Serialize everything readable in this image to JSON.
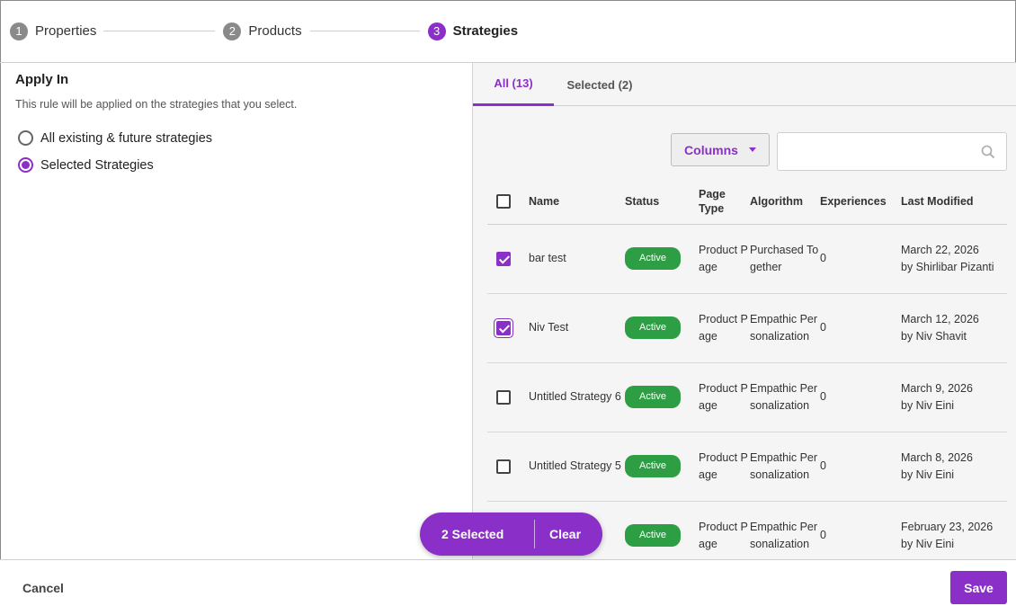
{
  "stepper": {
    "steps": [
      {
        "num": "1",
        "label": "Properties"
      },
      {
        "num": "2",
        "label": "Products"
      },
      {
        "num": "3",
        "label": "Strategies"
      }
    ]
  },
  "apply": {
    "title": "Apply In",
    "description": "This rule will be applied on the strategies that you select.",
    "options": [
      {
        "label": "All existing & future strategies",
        "checked": false
      },
      {
        "label": "Selected Strategies",
        "checked": true
      }
    ]
  },
  "tabs": [
    {
      "label": "All (13)",
      "active": true
    },
    {
      "label": "Selected (2)",
      "active": false
    }
  ],
  "toolbar": {
    "columns_label": "Columns",
    "search_placeholder": ""
  },
  "table": {
    "headers": [
      "Name",
      "Status",
      "Page Type",
      "Algorithm",
      "Experiences",
      "Last Modified"
    ],
    "rows": [
      {
        "checked": true,
        "name": "bar test",
        "status": "Active",
        "page_type": "Product Page",
        "algorithm": "Purchased Together",
        "experiences": "0",
        "modified_date": "March 22, 2026",
        "modified_by": "by Shirlibar Pizanti"
      },
      {
        "checked": true,
        "name": "Niv Test",
        "status": "Active",
        "page_type": "Product Page",
        "algorithm": "Empathic Personalization",
        "experiences": "0",
        "modified_date": "March 12, 2026",
        "modified_by": "by Niv Shavit"
      },
      {
        "checked": false,
        "name": "Untitled Strategy 6",
        "status": "Active",
        "page_type": "Product Page",
        "algorithm": "Empathic Personalization",
        "experiences": "0",
        "modified_date": "March 9, 2026",
        "modified_by": "by Niv Eini"
      },
      {
        "checked": false,
        "name": "Untitled Strategy 5",
        "status": "Active",
        "page_type": "Product Page",
        "algorithm": "Empathic Personalization",
        "experiences": "0",
        "modified_date": "March 8, 2026",
        "modified_by": "by Niv Eini"
      },
      {
        "checked": false,
        "name": "",
        "status": "Active",
        "page_type": "Product Page",
        "algorithm": "Empathic Personalization",
        "experiences": "0",
        "modified_date": "February 23, 2026",
        "modified_by": "by Niv Eini"
      }
    ]
  },
  "selection_bar": {
    "count_label": "2 Selected",
    "clear_label": "Clear"
  },
  "footer": {
    "cancel_label": "Cancel",
    "save_label": "Save"
  },
  "colors": {
    "accent": "#8b2fc9",
    "active_badge": "#2e9e45"
  }
}
